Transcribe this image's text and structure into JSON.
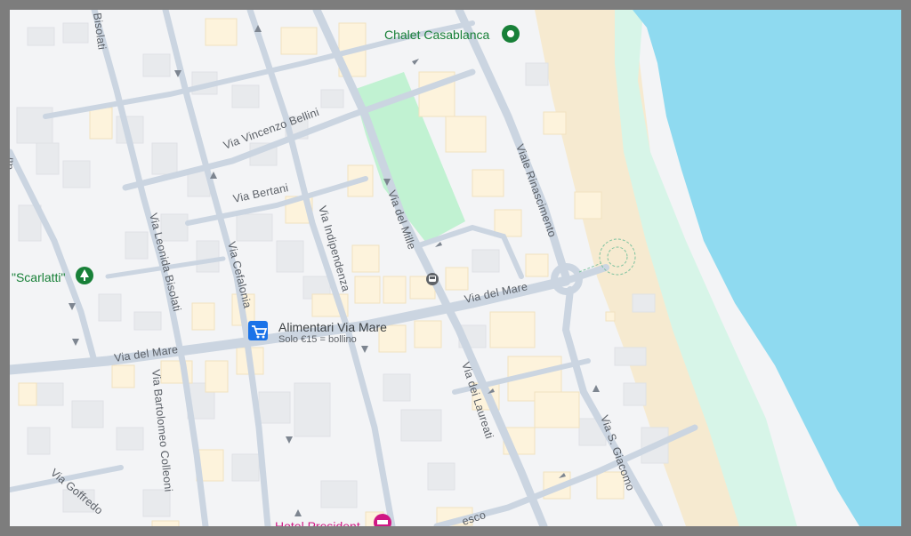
{
  "map": {
    "streets": {
      "bisolati": "Bisolati",
      "vincenzo_bellini": "Via Vincenzo Bellini",
      "bertani": "Via Bertani",
      "leonida_bisolati": "Via Leonida Bisolati",
      "cefalonia": "Via Cefalonia",
      "indipendenza": "Via Indipendenza",
      "del_mille": "Via del Mille",
      "rinascimento": "Viale Rinascimento",
      "del_mare_east": "Via del Mare",
      "del_mare_west": "Via del Mare",
      "bartolomeo_colleoni": "Via Bartolomeo Colleoni",
      "goffredo": "Via Goffredo",
      "dei_laureati": "Via dei Laureati",
      "s_giacomo": "Via S. Giacomo",
      "partial_left": "ati",
      "partial_bottom": "esco"
    },
    "pois": {
      "chalet": {
        "name": "Chalet Casablanca",
        "color": "#188038"
      },
      "scarlatti": {
        "name": "\"Scarlatti\"",
        "color": "#188038"
      },
      "alimentari": {
        "name": "Alimentari Via Mare",
        "sub": "Solo €15 = bollino",
        "color": "#1a73e8"
      },
      "hotel": {
        "name": "Hotel President",
        "color": "#d01884"
      }
    },
    "colors": {
      "sea": "#8fdaf0",
      "beach": "#f6ead0",
      "shore": "#d7f5e8",
      "park": "#c1f2d2",
      "road": "#cbd5e1",
      "building": "#fdf3dc",
      "building_grey": "#e8eaed",
      "land": "#f3f4f6"
    }
  }
}
